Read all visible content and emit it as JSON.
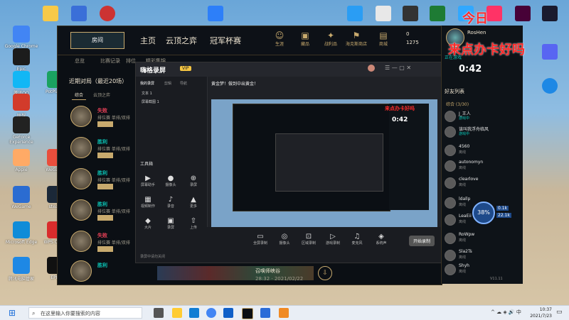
{
  "desktop": {
    "left_icons": [
      "Google Chrome",
      "Epic",
      "腾讯QQ",
      "联想",
      "PotPlayer",
      "GeForce Experience",
      "Apple",
      "WeGame",
      "steam",
      "Microsoft Edge",
      "WPS Office",
      "腾讯电脑管家",
      "EPIC",
      "回收站"
    ],
    "top_icons": [
      "",
      "",
      "",
      "",
      "",
      "",
      "",
      "",
      ""
    ]
  },
  "lol": {
    "play_label": "房间",
    "nav": [
      "主页",
      "云顶之弈",
      "冠军杯赛"
    ],
    "icons": [
      {
        "glyph": "☺",
        "label": "生涯"
      },
      {
        "glyph": "▣",
        "label": "藏品"
      },
      {
        "glyph": "✦",
        "label": "战利品"
      },
      {
        "glyph": "⚑",
        "label": "海克斯商店"
      },
      {
        "glyph": "▤",
        "label": "商城"
      }
    ],
    "currency": [
      "0",
      "1275"
    ],
    "sub_tabs": [
      "总览",
      "比赛记录",
      "排位",
      "精彩集锦"
    ],
    "match_title": "近期对局（最近20场）",
    "match_tabs": [
      "综合",
      "云顶之弈"
    ],
    "matches": [
      {
        "result": "失败",
        "mode": "排位赛 单排/双排",
        "color": "#e84057",
        "level": "17"
      },
      {
        "result": "胜利",
        "mode": "排位赛 单排/双排",
        "color": "#0ac8b9",
        "level": "16"
      },
      {
        "result": "胜利",
        "mode": "排位赛 单排/双排",
        "color": "#0ac8b9",
        "level": "17"
      },
      {
        "result": "胜利",
        "mode": "排位赛 单排/双排",
        "color": "#0ac8b9",
        "level": "9"
      },
      {
        "result": "失败",
        "mode": "排位赛 单排/双排",
        "color": "#e84057",
        "level": "17"
      },
      {
        "result": "胜利",
        "mode": "排位赛 单排/双排",
        "color": "#0ac8b9",
        "level": ""
      }
    ],
    "bottom_name": "召唤师峡谷",
    "bottom_date": "28:32 · 2021/02/22"
  },
  "recorder": {
    "brand": "嗨格录屏",
    "badge": "VIP",
    "left_tabs": [
      "我的录屏",
      "剪辑",
      "导航"
    ],
    "files": [
      "文本 1",
      "屏幕截图 1"
    ],
    "tool_section": "工具箱",
    "tools": [
      {
        "glyph": "▶",
        "label": "屏幕助手"
      },
      {
        "glyph": "●",
        "label": "摄像头"
      },
      {
        "glyph": "⊕",
        "label": "录屏"
      },
      {
        "glyph": "▦",
        "label": "视频制作"
      },
      {
        "glyph": "♪",
        "label": "录音"
      },
      {
        "glyph": "▲",
        "label": "更多"
      },
      {
        "glyph": "◆",
        "label": "大片"
      },
      {
        "glyph": "▣",
        "label": "录屏"
      },
      {
        "glyph": "⇧",
        "label": "上传"
      }
    ],
    "tip": "录屏中请勿关闭",
    "top_banner": "黄金梦！做到中出黄金！",
    "record_btns": [
      {
        "glyph": "▭",
        "label": "全屏录制"
      },
      {
        "glyph": "◎",
        "label": "摄像头"
      },
      {
        "glyph": "⊡",
        "label": "区域录制"
      },
      {
        "glyph": "▷",
        "label": "游戏录制"
      },
      {
        "glyph": "♫",
        "label": "麦克风"
      },
      {
        "glyph": "◈",
        "label": "系统声"
      }
    ],
    "start_label": "开始录制"
  },
  "friends": {
    "name": "RosHen",
    "status": "正在游戏",
    "timer": "0:42",
    "section_title": "好友列表",
    "group": "综合 (3/30)",
    "list": [
      {
        "name": "J_王人",
        "status": "游戏中"
      },
      {
        "name": "该叫我浮舟临风",
        "status": "游戏中"
      },
      {
        "name": "4560",
        "status": "离线"
      },
      {
        "name": "autonomyn",
        "status": "离线"
      },
      {
        "name": "clearlove",
        "status": "离线"
      },
      {
        "name": "ldallp",
        "status": "离线"
      },
      {
        "name": "LeaEii",
        "status": "离线"
      },
      {
        "name": "RoWpw",
        "status": "离线"
      },
      {
        "name": "Sla2Ts",
        "status": "离线"
      },
      {
        "name": "Shyh",
        "status": "离线"
      }
    ],
    "version": "V11.11"
  },
  "overlay": {
    "line1": "今日",
    "line2": "来点办卡好吗",
    "percent": "38%",
    "speed1": "0.1k",
    "speed2": "22.1k"
  },
  "taskbar": {
    "search_placeholder": "在这里输入你要搜索的内容",
    "time": "10:37",
    "date": "2021/7/23"
  },
  "colors": {
    "gold": "#c8aa6e",
    "win": "#0ac8b9",
    "loss": "#e84057",
    "overlay_red": "#ff2a2a"
  }
}
